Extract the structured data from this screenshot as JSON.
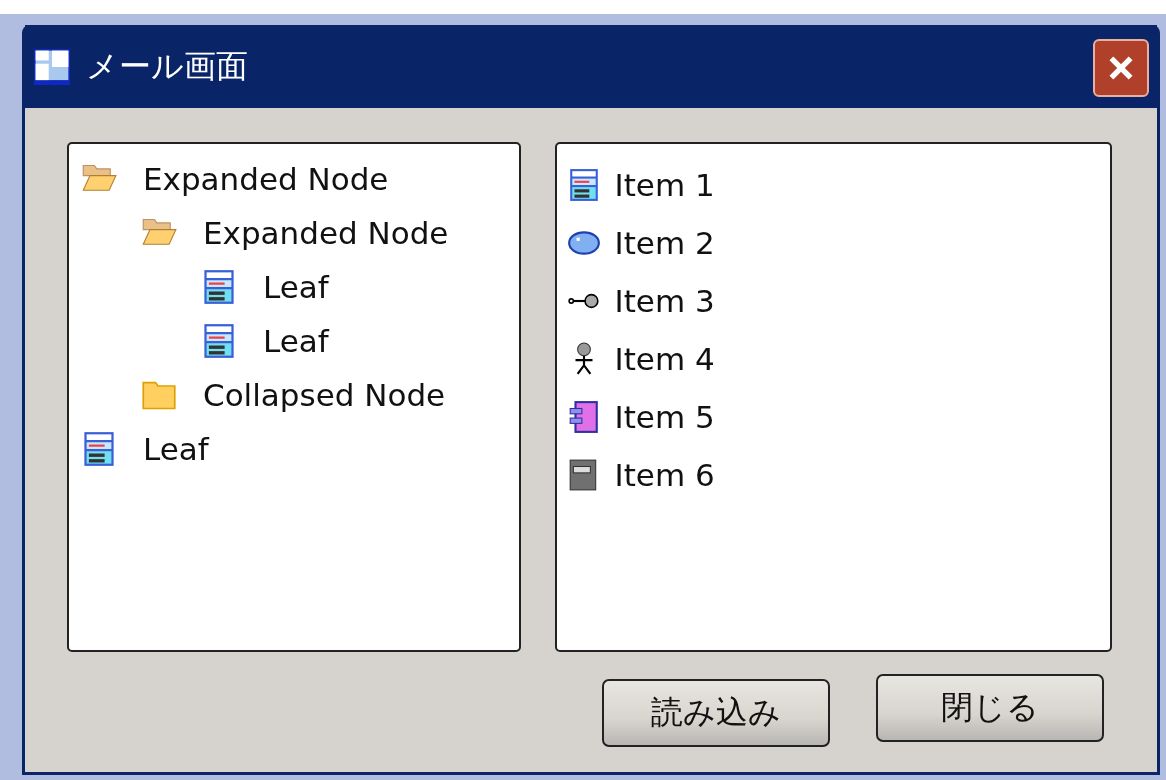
{
  "window": {
    "title": "メール画面"
  },
  "tree": [
    {
      "label": "Expanded Node",
      "kind": "folder",
      "expanded": true,
      "children": [
        {
          "label": "Expanded Node",
          "kind": "folder",
          "expanded": true,
          "children": [
            {
              "label": "Leaf",
              "kind": "leaf"
            },
            {
              "label": "Leaf",
              "kind": "leaf"
            }
          ]
        },
        {
          "label": "Collapsed Node",
          "kind": "folder",
          "expanded": false
        }
      ]
    },
    {
      "label": "Leaf",
      "kind": "leaf"
    }
  ],
  "list": [
    {
      "label": "Item 1",
      "kind": "form"
    },
    {
      "label": "Item 2",
      "kind": "ellipse"
    },
    {
      "label": "Item 3",
      "kind": "interface"
    },
    {
      "label": "Item 4",
      "kind": "actor"
    },
    {
      "label": "Item 5",
      "kind": "component"
    },
    {
      "label": "Item 6",
      "kind": "box"
    }
  ],
  "buttons": [
    "読み込み",
    "閉じる"
  ]
}
